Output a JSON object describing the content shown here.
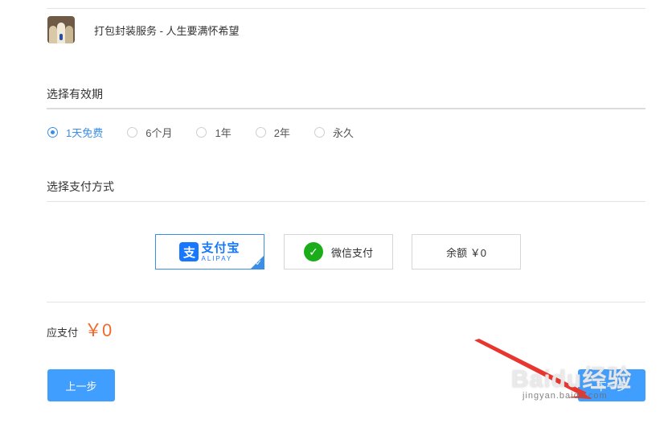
{
  "service": {
    "name": "打包封装服务 - 人生要满怀希望"
  },
  "validity": {
    "title": "选择有效期",
    "options": [
      {
        "label": "1天免费",
        "selected": true
      },
      {
        "label": "6个月",
        "selected": false
      },
      {
        "label": "1年",
        "selected": false
      },
      {
        "label": "2年",
        "selected": false
      },
      {
        "label": "永久",
        "selected": false
      }
    ]
  },
  "payment": {
    "title": "选择支付方式",
    "methods": [
      {
        "cn": "支付宝",
        "en": "ALIPAY",
        "icon": "alipay-icon",
        "selected": true
      },
      {
        "label": "微信支付",
        "icon": "wechat-icon",
        "selected": false
      },
      {
        "label": "余额 ￥0",
        "selected": false
      }
    ]
  },
  "total": {
    "label": "应支付",
    "amount": "￥0"
  },
  "buttons": {
    "prev": "上一步",
    "next": "下一步"
  },
  "watermark": {
    "main": "Baidu经验",
    "sub": "jingyan.baidu.com"
  },
  "colors": {
    "accent": "#409eff",
    "selected_blue": "#3a8ee6",
    "price": "#f06a2b",
    "wechat_green": "#1aad19",
    "alipay_blue": "#1677ff",
    "annotation_arrow": "#e8352e"
  }
}
